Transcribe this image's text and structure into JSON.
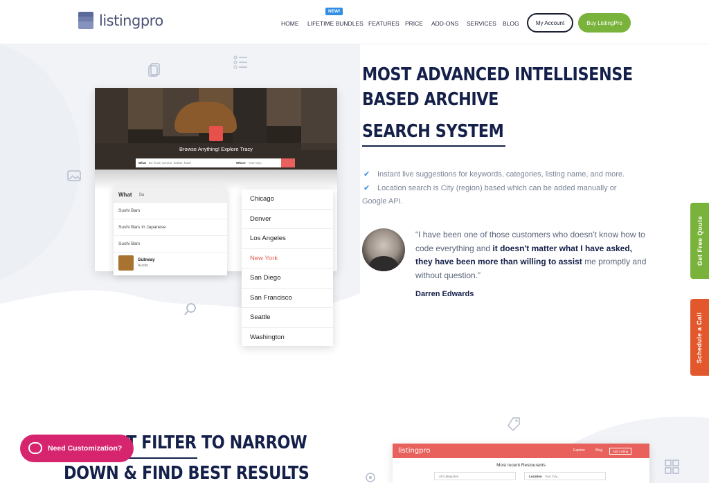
{
  "header": {
    "logo_text": "listingpro",
    "nav": [
      {
        "label": "HOME"
      },
      {
        "label": "LIFETIME BUNDLES"
      },
      {
        "label": "FEATURES"
      },
      {
        "label": "PRICE"
      },
      {
        "label": "ADD-ONS"
      },
      {
        "label": "SERVICES"
      },
      {
        "label": "BLOG"
      }
    ],
    "new_badge": "NEW!",
    "my_account": "My Account",
    "buy": "Buy ListingPro"
  },
  "mock": {
    "hero_text": "Browse Anything! Explore Tracy",
    "what_label": "What",
    "what_placeholder": "Ex: food, service, barber, hotel",
    "where_label": "Where",
    "where_placeholder": "Your City...",
    "ac_label": "What",
    "ac_query": "Su",
    "ac_items": [
      "Sushi Bars",
      "Sushi Bars In Japanese",
      "Sushi Bars"
    ],
    "ac_listing_name": "Subway",
    "ac_listing_city": "Austin",
    "cities": [
      "Chicago",
      "Denver",
      "Los Angeles",
      "New York",
      "San Diego",
      "San Francisco",
      "Seattle",
      "Washington"
    ],
    "active_city": "New York"
  },
  "right": {
    "headline": [
      "MOST ADVANCED INTELLISENSE",
      "BASED ARCHIVE",
      "SEARCH SYSTEM"
    ],
    "features": [
      "Instant live suggestions for keywords, categories, listing name, and more.",
      "Location search is City (region) based which can be added manually or",
      "Google API."
    ],
    "quote_part1": "“I have been one of those customers who doesn't know how to code everything and ",
    "quote_bold": "it doesn't matter what I have asked, they have been more than willing to assist",
    "quote_part2": " me promptly and without question.”",
    "author": "Darren Edwards"
  },
  "side_tabs": {
    "quote": "Get Free Qoute",
    "call": "Schedule a Call"
  },
  "lower": {
    "headline": [
      "INSTANT FILTER TO NARROW",
      "DOWN & FIND BEST RESULTS"
    ],
    "chat_label": "Need Customization?",
    "mock_logo": "listingpro",
    "mock_explore": "Explore",
    "mock_blog": "Blog",
    "mock_add": "Add Listing",
    "mock_title": "Most recent Restourants",
    "mock_categories": "All Categories",
    "mock_location": "Location",
    "mock_city": "Your City..."
  },
  "colors": {
    "brand_navy": "#15204a",
    "accent_green": "#7ab33b",
    "accent_orange": "#e2582c",
    "accent_red": "#e8615c",
    "chat_pink": "#d6246e",
    "link_blue": "#2f8ee3"
  }
}
